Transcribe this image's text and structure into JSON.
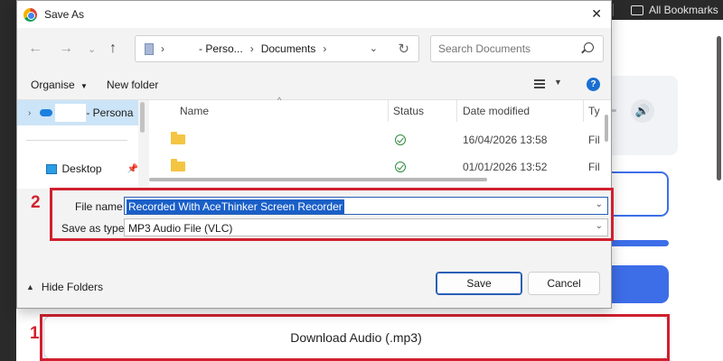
{
  "browser": {
    "bookmarks_label": "All Bookmarks",
    "download_button": "Download Audio (.mp3)",
    "step_one": "1",
    "step_two": "2"
  },
  "dialog": {
    "title": "Save As",
    "address": {
      "segments": [
        "- Perso...",
        "Documents"
      ]
    },
    "search_placeholder": "Search Documents",
    "toolbar": {
      "organise": "Organise",
      "new_folder": "New folder",
      "help": "?"
    },
    "sidebar": {
      "items": [
        {
          "label": "- Persona",
          "selected": true
        },
        {
          "label": "Desktop",
          "selected": false
        }
      ]
    },
    "columns": [
      "Name",
      "Status",
      "Date modified",
      "Ty"
    ],
    "rows": [
      {
        "name": "",
        "date": "16/04/2026 13:58",
        "type": "Fil"
      },
      {
        "name": "",
        "date": "01/01/2026 13:52",
        "type": "Fil"
      }
    ],
    "file_name_label": "File name:",
    "file_name_value": "Recorded With AceThinker Screen Recorder",
    "save_type_label": "Save as type:",
    "save_type_value": "MP3 Audio File (VLC)",
    "hide_folders": "Hide Folders",
    "save_button": "Save",
    "cancel_button": "Cancel"
  },
  "colors": {
    "highlight": "#d0202e",
    "accent_blue": "#3d6ee8",
    "selection_blue": "#1a5fc8"
  }
}
